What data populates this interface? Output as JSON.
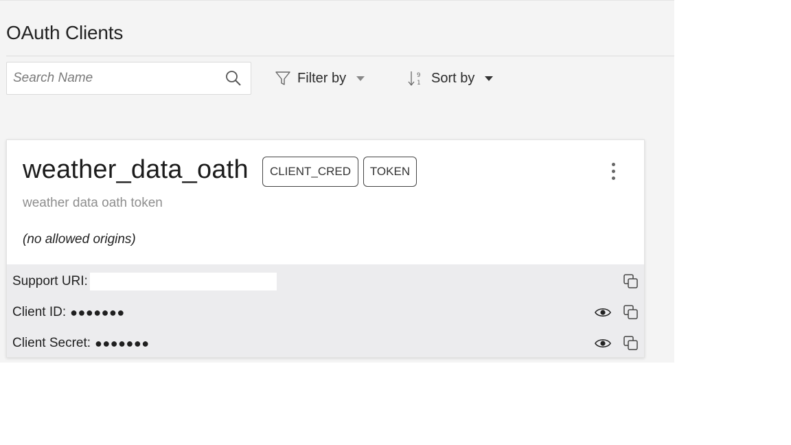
{
  "header": {
    "title": "OAuth Clients"
  },
  "search": {
    "placeholder": "Search Name",
    "value": "",
    "icon": "search-icon"
  },
  "toolbar": {
    "filter_label": "Filter by",
    "sort_label": "Sort by",
    "filter_icon": "filter-funnel-icon",
    "sort_icon": "sort-icon"
  },
  "clients": [
    {
      "name": "weather_data_oath",
      "badges": [
        "CLIENT_CRED",
        "TOKEN"
      ],
      "description": "weather data oath token",
      "origins_text": "(no allowed origins)",
      "support_uri_label": "Support URI:",
      "client_id_label": "Client ID:",
      "client_id_masked": "●●●●●●●",
      "client_secret_label": "Client Secret:",
      "client_secret_masked": "●●●●●●●"
    }
  ],
  "colors": {
    "panel_bg": "#f4f4f4",
    "details_bg": "#ececee",
    "muted_text": "#8e8e8e"
  }
}
